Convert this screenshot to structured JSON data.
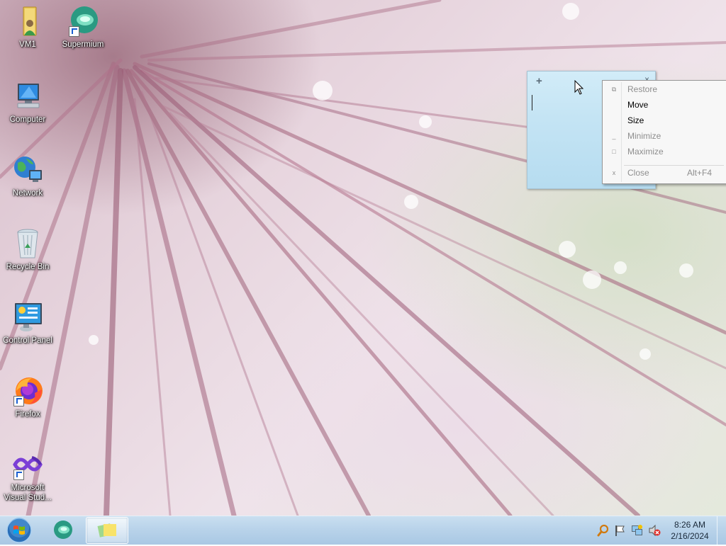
{
  "desktop": {
    "icons": [
      {
        "label": "VM1",
        "icon": "user-folder-icon",
        "shortcut": false
      },
      {
        "label": "Supermium",
        "icon": "supermium-icon",
        "shortcut": true
      },
      {
        "label": "Computer",
        "icon": "computer-icon",
        "shortcut": false
      },
      {
        "label": "Network",
        "icon": "network-icon",
        "shortcut": false
      },
      {
        "label": "Recycle Bin",
        "icon": "recycle-bin-icon",
        "shortcut": false
      },
      {
        "label": "Control Panel",
        "icon": "control-panel-icon",
        "shortcut": false
      },
      {
        "label": "Firefox",
        "icon": "firefox-icon",
        "shortcut": true
      },
      {
        "label": "Microsoft Visual Stud...",
        "icon": "visual-studio-icon",
        "shortcut": true
      }
    ]
  },
  "sticky_note": {
    "add_glyph": "+",
    "close_glyph": "×",
    "text": ""
  },
  "context_menu": {
    "items": [
      {
        "label": "Restore",
        "accelerator": "",
        "enabled": false,
        "glyph": "⧉"
      },
      {
        "label": "Move",
        "accelerator": "",
        "enabled": true,
        "glyph": ""
      },
      {
        "label": "Size",
        "accelerator": "",
        "enabled": true,
        "glyph": ""
      },
      {
        "label": "Minimize",
        "accelerator": "",
        "enabled": false,
        "glyph": "_"
      },
      {
        "label": "Maximize",
        "accelerator": "",
        "enabled": false,
        "glyph": "□"
      },
      {
        "label": "Close",
        "accelerator": "Alt+F4",
        "enabled": false,
        "glyph": "x"
      }
    ]
  },
  "taskbar": {
    "pinned": [
      "start-button",
      "supermium-taskbar-button",
      "sticky-notes-taskbar-button"
    ],
    "tray_icons": [
      "search-icon",
      "action-center-flag-icon",
      "network-icon",
      "volume-muted-icon"
    ],
    "time": "8:26 AM",
    "date": "2/16/2024"
  },
  "colors": {
    "taskbar": "#b9d3ea",
    "note": "#c4e4f4",
    "menu_bg": "#f7f7f7"
  }
}
